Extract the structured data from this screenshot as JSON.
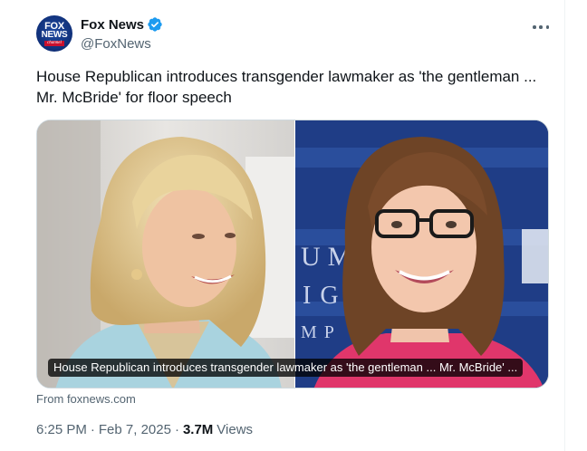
{
  "author": {
    "name": "Fox News",
    "handle": "@FoxNews",
    "avatar_text": {
      "fox": "FOX",
      "news": "NEWS",
      "channel": "channel"
    },
    "verified_color": "#1d9bf0"
  },
  "tweet": {
    "text": "House Republican introduces transgender lawmaker as 'the gentleman ... Mr. McBride' for floor speech",
    "media_caption": "House Republican introduces transgender lawmaker as 'the gentleman ... Mr. McBride' ...",
    "source": "From foxnews.com",
    "time": "6:25 PM",
    "date": "Feb 7, 2025",
    "separator": "·",
    "views_count": "3.7M",
    "views_label": "Views"
  },
  "icons": {
    "more": "more-horizontal-icon",
    "verified": "verified-badge-icon"
  },
  "colors": {
    "text_primary": "#0f1419",
    "text_secondary": "#536471",
    "border": "#cfd9de",
    "right_photo_backdrop": "#1f3d86"
  }
}
